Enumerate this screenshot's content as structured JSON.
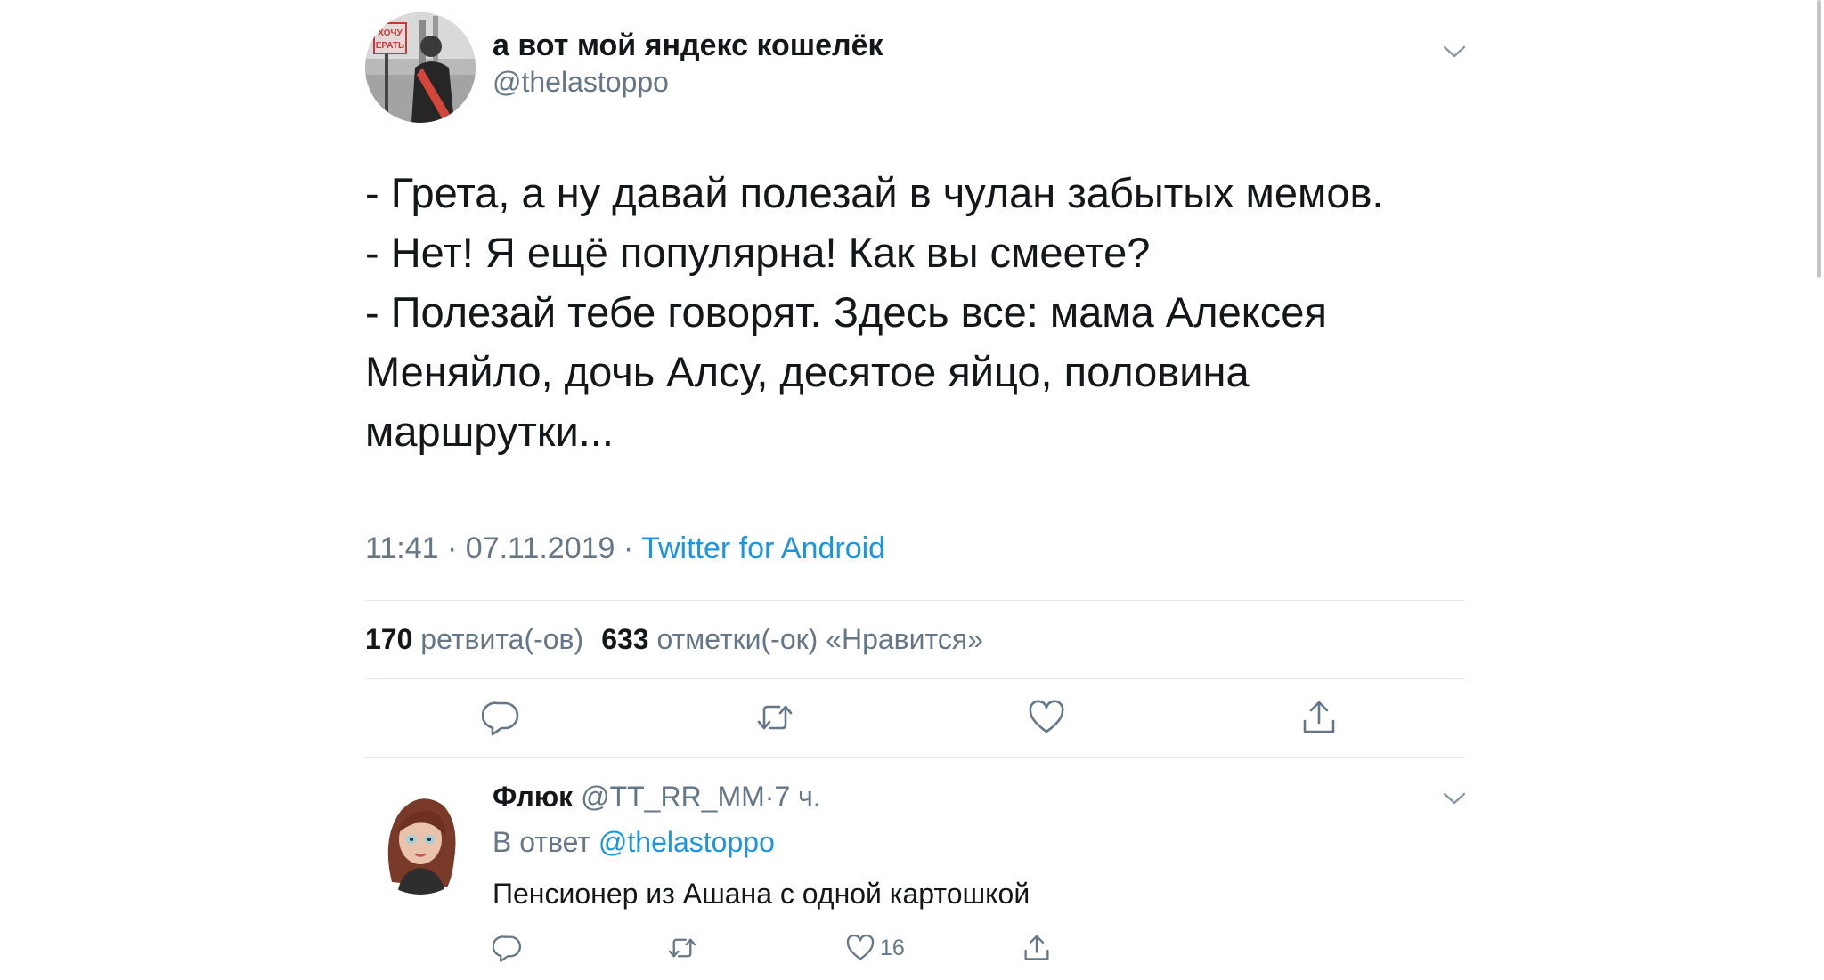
{
  "tweet": {
    "author_name": "а вот мой яндекс кошелёк",
    "author_handle": "@thelastoppo",
    "avatar_sign_lines": [
      "ХОЧУ",
      "ЕРАТЬ"
    ],
    "text_lines": [
      "- Грета, а ну давай полезай в чулан забытых мемов.",
      "- Нет! Я ещё популярна! Как вы смеете?",
      "- Полезай тебе говорят. Здесь все: мама Алексея",
      "Меняйло, дочь Алсу, десятое яйцо, половина",
      "маршрутки..."
    ],
    "time": "11:41",
    "date": "07.11.2019",
    "separator": "·",
    "source": "Twitter for Android",
    "retweets_count": "170",
    "retweets_label": "ретвита(-ов)",
    "likes_count": "633",
    "likes_label": "отметки(-ок) «Нравится»"
  },
  "reply": {
    "author_name": "Флюк",
    "author_handle": "@TT_RR_MM",
    "separator": "·",
    "time_ago": "7 ч.",
    "reply_to_label": "В ответ",
    "reply_to_handle": "@thelastoppo",
    "text": "Пенсионер из Ашана с одной картошкой",
    "like_count": "16"
  },
  "icons": {
    "main_actions": [
      "reply-icon",
      "retweet-icon",
      "like-icon",
      "share-icon"
    ],
    "reply_actions": [
      "reply-icon",
      "retweet-icon",
      "like-icon",
      "share-icon"
    ],
    "menu": "chevron-down-icon"
  },
  "colors": {
    "text": "#14171a",
    "secondary": "#657786",
    "link": "#1b95e0",
    "divider": "#e1e8ed"
  }
}
